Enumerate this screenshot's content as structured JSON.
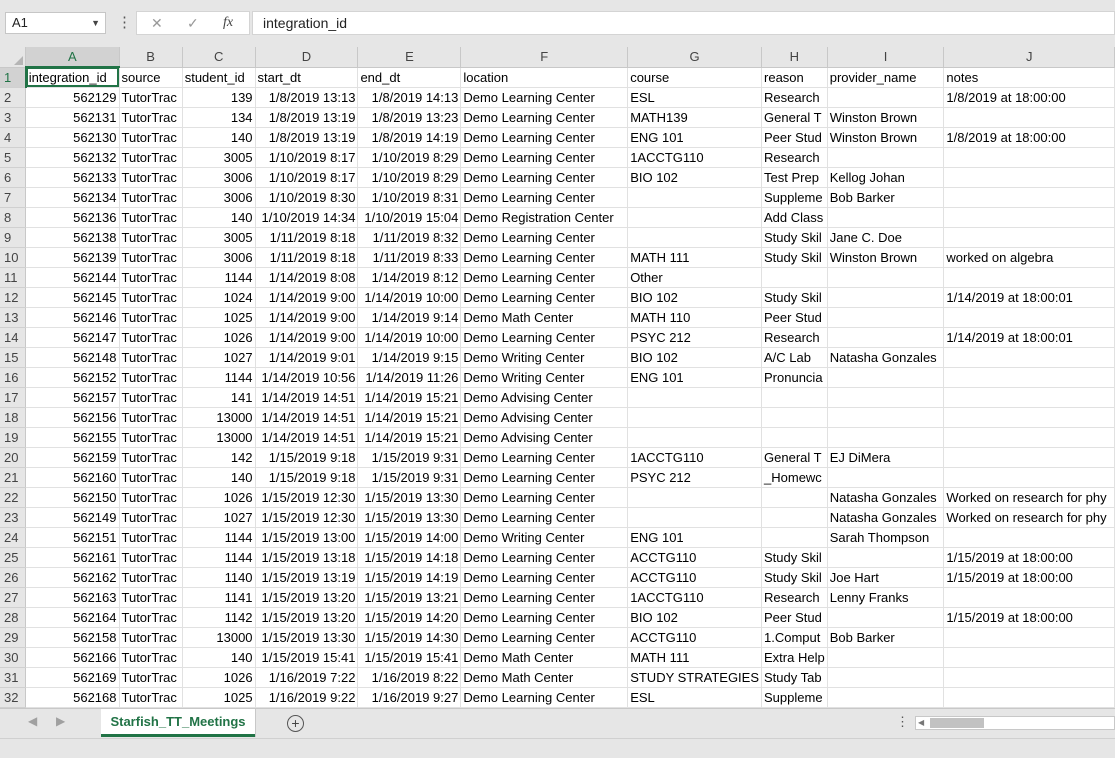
{
  "formula_bar": {
    "name_box": "A1",
    "formula": "integration_id",
    "cancel_symbol": "✕",
    "enter_symbol": "✓",
    "fx_symbol": "fx"
  },
  "columns": [
    "A",
    "B",
    "C",
    "D",
    "E",
    "F",
    "G",
    "H",
    "I",
    "J"
  ],
  "header_row": [
    "integration_id",
    "source",
    "student_id",
    "start_dt",
    "end_dt",
    "location",
    "course",
    "reason",
    "provider_name",
    "notes"
  ],
  "rows": [
    [
      "562129",
      "TutorTrac",
      "139",
      "1/8/2019 13:13",
      "1/8/2019 14:13",
      "Demo Learning Center",
      "ESL",
      "Research",
      "",
      "1/8/2019 at 18:00:00"
    ],
    [
      "562131",
      "TutorTrac",
      "134",
      "1/8/2019 13:19",
      "1/8/2019 13:23",
      "Demo Learning Center",
      "MATH139",
      "General T",
      "Winston Brown",
      ""
    ],
    [
      "562130",
      "TutorTrac",
      "140",
      "1/8/2019 13:19",
      "1/8/2019 14:19",
      "Demo Learning Center",
      "ENG 101",
      "Peer Stud",
      "Winston Brown",
      "1/8/2019 at 18:00:00"
    ],
    [
      "562132",
      "TutorTrac",
      "3005",
      "1/10/2019 8:17",
      "1/10/2019 8:29",
      "Demo Learning Center",
      "1ACCTG110",
      "Research",
      "",
      ""
    ],
    [
      "562133",
      "TutorTrac",
      "3006",
      "1/10/2019 8:17",
      "1/10/2019 8:29",
      "Demo Learning Center",
      "BIO 102",
      "Test Prep",
      "Kellog Johan",
      ""
    ],
    [
      "562134",
      "TutorTrac",
      "3006",
      "1/10/2019 8:30",
      "1/10/2019 8:31",
      "Demo Learning Center",
      "",
      "Suppleme",
      "Bob Barker",
      ""
    ],
    [
      "562136",
      "TutorTrac",
      "140",
      "1/10/2019 14:34",
      "1/10/2019 15:04",
      "Demo Registration Center",
      "",
      "Add Class",
      "",
      ""
    ],
    [
      "562138",
      "TutorTrac",
      "3005",
      "1/11/2019 8:18",
      "1/11/2019 8:32",
      "Demo Learning Center",
      "",
      "Study Skil",
      "Jane C. Doe",
      ""
    ],
    [
      "562139",
      "TutorTrac",
      "3006",
      "1/11/2019 8:18",
      "1/11/2019 8:33",
      "Demo Learning Center",
      "MATH 111",
      "Study Skil",
      "Winston Brown",
      "worked on algebra"
    ],
    [
      "562144",
      "TutorTrac",
      "1144",
      "1/14/2019 8:08",
      "1/14/2019 8:12",
      "Demo Learning Center",
      "Other",
      "",
      "",
      ""
    ],
    [
      "562145",
      "TutorTrac",
      "1024",
      "1/14/2019 9:00",
      "1/14/2019 10:00",
      "Demo Learning Center",
      "BIO 102",
      "Study Skil",
      "",
      "1/14/2019 at 18:00:01"
    ],
    [
      "562146",
      "TutorTrac",
      "1025",
      "1/14/2019 9:00",
      "1/14/2019 9:14",
      "Demo Math Center",
      "MATH 110",
      "Peer Stud",
      "",
      ""
    ],
    [
      "562147",
      "TutorTrac",
      "1026",
      "1/14/2019 9:00",
      "1/14/2019 10:00",
      "Demo Learning Center",
      "PSYC 212",
      "Research",
      "",
      "1/14/2019 at 18:00:01"
    ],
    [
      "562148",
      "TutorTrac",
      "1027",
      "1/14/2019 9:01",
      "1/14/2019 9:15",
      "Demo Writing Center",
      "BIO 102",
      "A/C Lab",
      "Natasha Gonzales",
      ""
    ],
    [
      "562152",
      "TutorTrac",
      "1144",
      "1/14/2019 10:56",
      "1/14/2019 11:26",
      "Demo Writing Center",
      "ENG 101",
      "Pronuncia",
      "",
      ""
    ],
    [
      "562157",
      "TutorTrac",
      "141",
      "1/14/2019 14:51",
      "1/14/2019 15:21",
      "Demo Advising Center",
      "",
      "",
      "",
      ""
    ],
    [
      "562156",
      "TutorTrac",
      "13000",
      "1/14/2019 14:51",
      "1/14/2019 15:21",
      "Demo Advising Center",
      "",
      "",
      "",
      ""
    ],
    [
      "562155",
      "TutorTrac",
      "13000",
      "1/14/2019 14:51",
      "1/14/2019 15:21",
      "Demo Advising Center",
      "",
      "",
      "",
      ""
    ],
    [
      "562159",
      "TutorTrac",
      "142",
      "1/15/2019 9:18",
      "1/15/2019 9:31",
      "Demo Learning Center",
      "1ACCTG110",
      "General T",
      "EJ DiMera",
      ""
    ],
    [
      "562160",
      "TutorTrac",
      "140",
      "1/15/2019 9:18",
      "1/15/2019 9:31",
      "Demo Learning Center",
      "PSYC 212",
      "_Homewc",
      "",
      ""
    ],
    [
      "562150",
      "TutorTrac",
      "1026",
      "1/15/2019 12:30",
      "1/15/2019 13:30",
      "Demo Learning Center",
      "",
      "",
      "Natasha Gonzales",
      "Worked on research for phy"
    ],
    [
      "562149",
      "TutorTrac",
      "1027",
      "1/15/2019 12:30",
      "1/15/2019 13:30",
      "Demo Learning Center",
      "",
      "",
      "Natasha Gonzales",
      "Worked on research for phy"
    ],
    [
      "562151",
      "TutorTrac",
      "1144",
      "1/15/2019 13:00",
      "1/15/2019 14:00",
      "Demo Writing Center",
      "ENG 101",
      "",
      "Sarah Thompson",
      ""
    ],
    [
      "562161",
      "TutorTrac",
      "1144",
      "1/15/2019 13:18",
      "1/15/2019 14:18",
      "Demo Learning Center",
      "ACCTG110",
      "Study Skil",
      "",
      "1/15/2019 at 18:00:00"
    ],
    [
      "562162",
      "TutorTrac",
      "1140",
      "1/15/2019 13:19",
      "1/15/2019 14:19",
      "Demo Learning Center",
      "ACCTG110",
      "Study Skil",
      "Joe Hart",
      "1/15/2019 at 18:00:00"
    ],
    [
      "562163",
      "TutorTrac",
      "1141",
      "1/15/2019 13:20",
      "1/15/2019 13:21",
      "Demo Learning Center",
      "1ACCTG110",
      "Research",
      "Lenny Franks",
      ""
    ],
    [
      "562164",
      "TutorTrac",
      "1142",
      "1/15/2019 13:20",
      "1/15/2019 14:20",
      "Demo Learning Center",
      "BIO 102",
      "Peer Stud",
      "",
      "1/15/2019 at 18:00:00"
    ],
    [
      "562158",
      "TutorTrac",
      "13000",
      "1/15/2019 13:30",
      "1/15/2019 14:30",
      "Demo Learning Center",
      "ACCTG110",
      "1.Comput",
      "Bob Barker",
      ""
    ],
    [
      "562166",
      "TutorTrac",
      "140",
      "1/15/2019 15:41",
      "1/15/2019 15:41",
      "Demo Math Center",
      "MATH 111",
      "Extra Help",
      "",
      ""
    ],
    [
      "562169",
      "TutorTrac",
      "1026",
      "1/16/2019 7:22",
      "1/16/2019 8:22",
      "Demo Math Center",
      "STUDY STRATEGIES",
      "Study Tab",
      "",
      ""
    ],
    [
      "562168",
      "TutorTrac",
      "1025",
      "1/16/2019 9:22",
      "1/16/2019 9:27",
      "Demo Learning Center",
      "ESL",
      "Suppleme",
      "",
      ""
    ]
  ],
  "sheet_tab": {
    "name": "Starfish_TT_Meetings"
  },
  "colors": {
    "accent": "#217346",
    "chrome": "#e6e6e6",
    "gridline": "#e1e1e1"
  }
}
